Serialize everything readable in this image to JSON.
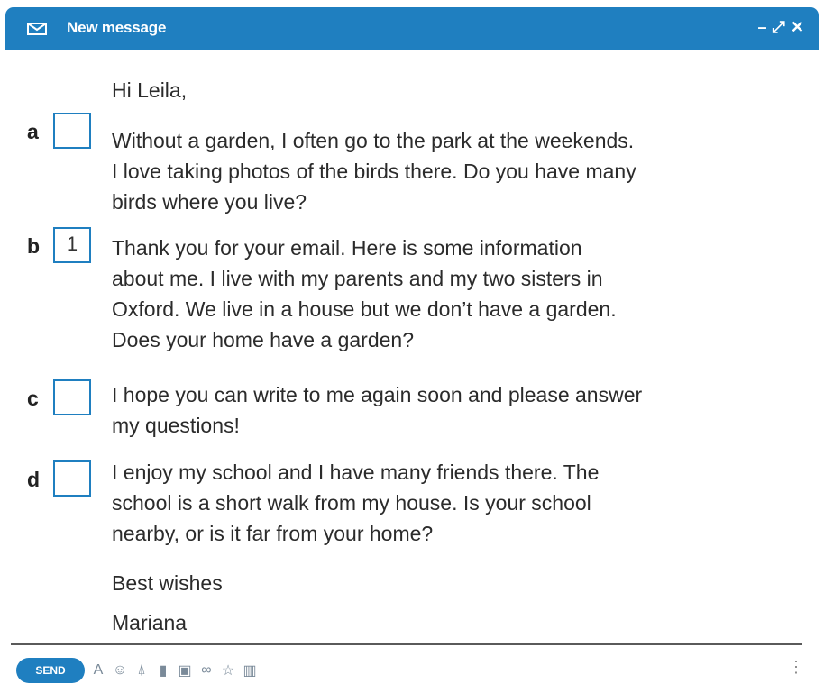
{
  "window": {
    "title": "New message",
    "controls": {
      "minimize": "–",
      "expand": "⤢",
      "close": "✕"
    }
  },
  "greeting": "Hi Leila,",
  "paragraphs": [
    {
      "letter": "a",
      "answer": "",
      "lines": [
        "Without a garden, I often go to the park at the weekends.",
        "I love taking photos of the birds there. Do you have many",
        "birds where you live?"
      ]
    },
    {
      "letter": "b",
      "answer": "1",
      "lines": [
        "Thank you for your email. Here is some information",
        "about me. I live with my parents and my two sisters in",
        "Oxford. We live in a house but we don’t have a garden.",
        "Does your home have a garden?"
      ]
    },
    {
      "letter": "c",
      "answer": "",
      "lines": [
        "I hope you can write to me again soon and please answer",
        "my questions!"
      ]
    },
    {
      "letter": "d",
      "answer": "",
      "lines": [
        "I enjoy my school and I have many friends there. The",
        "school is a short walk from my house. Is your school",
        "nearby, or is it far from your home?"
      ]
    }
  ],
  "closing": "Best wishes",
  "signature": "Mariana",
  "toolbar": {
    "send_label": "SEND",
    "tools": [
      {
        "name": "format-text-icon",
        "glyph": "A"
      },
      {
        "name": "emoji-icon",
        "glyph": "☺"
      },
      {
        "name": "attach-icon",
        "glyph": "⍋"
      },
      {
        "name": "drive-icon",
        "glyph": "▮"
      },
      {
        "name": "image-icon",
        "glyph": "▣"
      },
      {
        "name": "link-icon",
        "glyph": "∞"
      },
      {
        "name": "star-icon",
        "glyph": "☆"
      },
      {
        "name": "trash-icon",
        "glyph": "▥"
      }
    ],
    "more_glyph": "⋮"
  },
  "colors": {
    "accent": "#1f7fc0",
    "text": "#2b2b2b"
  }
}
